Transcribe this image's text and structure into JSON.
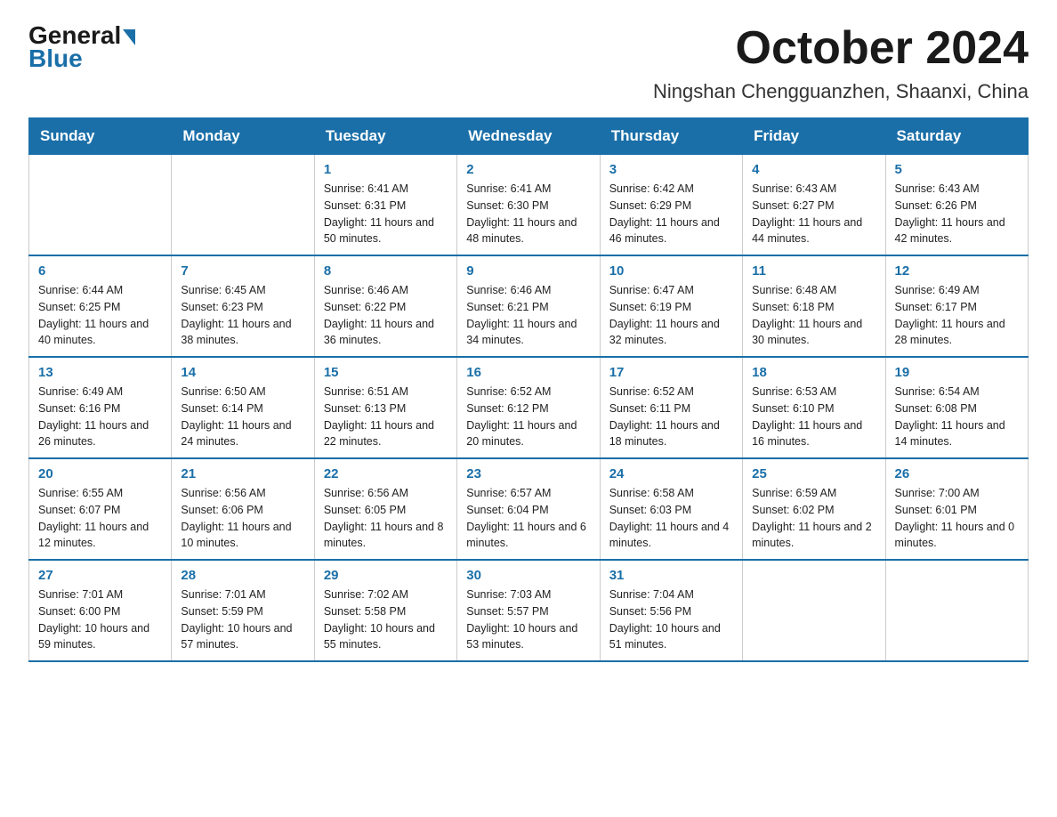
{
  "logo": {
    "general": "General",
    "blue": "Blue"
  },
  "title": "October 2024",
  "subtitle": "Ningshan Chengguanzhen, Shaanxi, China",
  "days_of_week": [
    "Sunday",
    "Monday",
    "Tuesday",
    "Wednesday",
    "Thursday",
    "Friday",
    "Saturday"
  ],
  "weeks": [
    [
      {
        "day": "",
        "info": ""
      },
      {
        "day": "",
        "info": ""
      },
      {
        "day": "1",
        "info": "Sunrise: 6:41 AM\nSunset: 6:31 PM\nDaylight: 11 hours and 50 minutes."
      },
      {
        "day": "2",
        "info": "Sunrise: 6:41 AM\nSunset: 6:30 PM\nDaylight: 11 hours and 48 minutes."
      },
      {
        "day": "3",
        "info": "Sunrise: 6:42 AM\nSunset: 6:29 PM\nDaylight: 11 hours and 46 minutes."
      },
      {
        "day": "4",
        "info": "Sunrise: 6:43 AM\nSunset: 6:27 PM\nDaylight: 11 hours and 44 minutes."
      },
      {
        "day": "5",
        "info": "Sunrise: 6:43 AM\nSunset: 6:26 PM\nDaylight: 11 hours and 42 minutes."
      }
    ],
    [
      {
        "day": "6",
        "info": "Sunrise: 6:44 AM\nSunset: 6:25 PM\nDaylight: 11 hours and 40 minutes."
      },
      {
        "day": "7",
        "info": "Sunrise: 6:45 AM\nSunset: 6:23 PM\nDaylight: 11 hours and 38 minutes."
      },
      {
        "day": "8",
        "info": "Sunrise: 6:46 AM\nSunset: 6:22 PM\nDaylight: 11 hours and 36 minutes."
      },
      {
        "day": "9",
        "info": "Sunrise: 6:46 AM\nSunset: 6:21 PM\nDaylight: 11 hours and 34 minutes."
      },
      {
        "day": "10",
        "info": "Sunrise: 6:47 AM\nSunset: 6:19 PM\nDaylight: 11 hours and 32 minutes."
      },
      {
        "day": "11",
        "info": "Sunrise: 6:48 AM\nSunset: 6:18 PM\nDaylight: 11 hours and 30 minutes."
      },
      {
        "day": "12",
        "info": "Sunrise: 6:49 AM\nSunset: 6:17 PM\nDaylight: 11 hours and 28 minutes."
      }
    ],
    [
      {
        "day": "13",
        "info": "Sunrise: 6:49 AM\nSunset: 6:16 PM\nDaylight: 11 hours and 26 minutes."
      },
      {
        "day": "14",
        "info": "Sunrise: 6:50 AM\nSunset: 6:14 PM\nDaylight: 11 hours and 24 minutes."
      },
      {
        "day": "15",
        "info": "Sunrise: 6:51 AM\nSunset: 6:13 PM\nDaylight: 11 hours and 22 minutes."
      },
      {
        "day": "16",
        "info": "Sunrise: 6:52 AM\nSunset: 6:12 PM\nDaylight: 11 hours and 20 minutes."
      },
      {
        "day": "17",
        "info": "Sunrise: 6:52 AM\nSunset: 6:11 PM\nDaylight: 11 hours and 18 minutes."
      },
      {
        "day": "18",
        "info": "Sunrise: 6:53 AM\nSunset: 6:10 PM\nDaylight: 11 hours and 16 minutes."
      },
      {
        "day": "19",
        "info": "Sunrise: 6:54 AM\nSunset: 6:08 PM\nDaylight: 11 hours and 14 minutes."
      }
    ],
    [
      {
        "day": "20",
        "info": "Sunrise: 6:55 AM\nSunset: 6:07 PM\nDaylight: 11 hours and 12 minutes."
      },
      {
        "day": "21",
        "info": "Sunrise: 6:56 AM\nSunset: 6:06 PM\nDaylight: 11 hours and 10 minutes."
      },
      {
        "day": "22",
        "info": "Sunrise: 6:56 AM\nSunset: 6:05 PM\nDaylight: 11 hours and 8 minutes."
      },
      {
        "day": "23",
        "info": "Sunrise: 6:57 AM\nSunset: 6:04 PM\nDaylight: 11 hours and 6 minutes."
      },
      {
        "day": "24",
        "info": "Sunrise: 6:58 AM\nSunset: 6:03 PM\nDaylight: 11 hours and 4 minutes."
      },
      {
        "day": "25",
        "info": "Sunrise: 6:59 AM\nSunset: 6:02 PM\nDaylight: 11 hours and 2 minutes."
      },
      {
        "day": "26",
        "info": "Sunrise: 7:00 AM\nSunset: 6:01 PM\nDaylight: 11 hours and 0 minutes."
      }
    ],
    [
      {
        "day": "27",
        "info": "Sunrise: 7:01 AM\nSunset: 6:00 PM\nDaylight: 10 hours and 59 minutes."
      },
      {
        "day": "28",
        "info": "Sunrise: 7:01 AM\nSunset: 5:59 PM\nDaylight: 10 hours and 57 minutes."
      },
      {
        "day": "29",
        "info": "Sunrise: 7:02 AM\nSunset: 5:58 PM\nDaylight: 10 hours and 55 minutes."
      },
      {
        "day": "30",
        "info": "Sunrise: 7:03 AM\nSunset: 5:57 PM\nDaylight: 10 hours and 53 minutes."
      },
      {
        "day": "31",
        "info": "Sunrise: 7:04 AM\nSunset: 5:56 PM\nDaylight: 10 hours and 51 minutes."
      },
      {
        "day": "",
        "info": ""
      },
      {
        "day": "",
        "info": ""
      }
    ]
  ]
}
